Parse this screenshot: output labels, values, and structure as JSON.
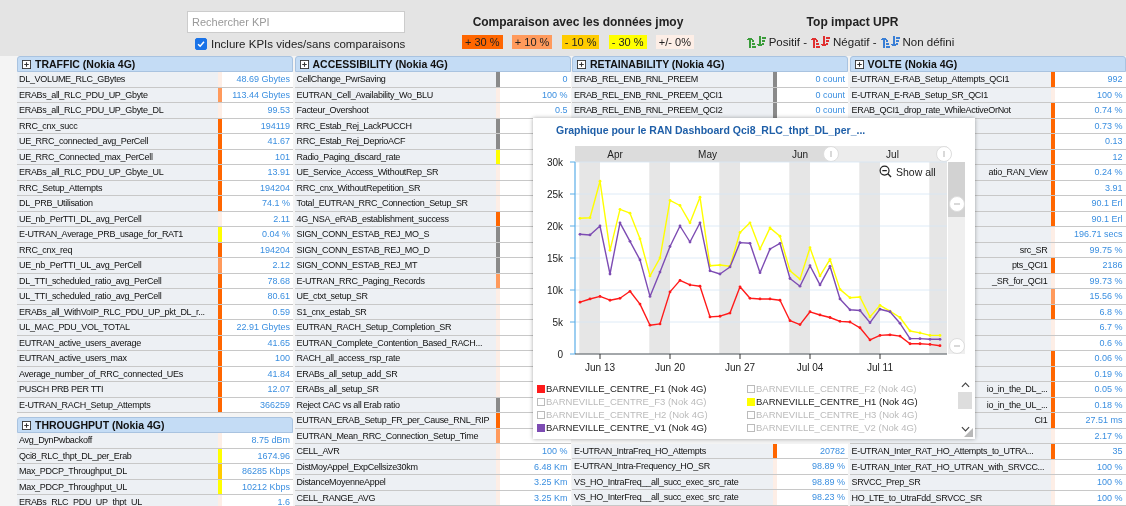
{
  "toolbar": {
    "search": {
      "placeholder": "Rechercher KPI"
    },
    "include_empty": {
      "label": "Inclure KPIs vides/sans comparaisons",
      "checked": true
    },
    "comparison": {
      "title": "Comparaison avec les données jmoy",
      "chips": [
        {
          "label": "+ 30 %",
          "color": "#ff6600"
        },
        {
          "label": "+ 10 %",
          "color": "#ff9a5c"
        },
        {
          "label": "- 10 %",
          "color": "#ffcc00"
        },
        {
          "label": "- 30 %",
          "color": "#ffff00"
        },
        {
          "label": "+/- 0%",
          "color": "#fdeee6"
        }
      ]
    },
    "impact": {
      "title": "Top impact UPR",
      "items": [
        {
          "label": "Positif -",
          "color": "#3a9c3a"
        },
        {
          "label": "Négatif -",
          "color": "#e03030"
        },
        {
          "label": "Non défini",
          "color": "#3a7fd5"
        }
      ]
    }
  },
  "columns": [
    {
      "sections": [
        {
          "title": "TRAFFIC (Nokia 4G)",
          "rows": [
            {
              "name": "DL_VOLUME_RLC_GBytes",
              "value": "48.69 Gbytes",
              "color": "#fdeee6"
            },
            {
              "name": "ERABs_all_RLC_PDU_UP_Gbyte",
              "value": "113.44 Gbytes",
              "color": "#ff9a5c"
            },
            {
              "name": "ERABs_all_RLC_PDU_UP_Gbyte_DL",
              "value": "99.53",
              "color": "#fdeee6"
            },
            {
              "name": "RRC_cnx_succ",
              "value": "194119",
              "color": "#ff6600"
            },
            {
              "name": "UE_RRC_connected_avg_PerCell",
              "value": "41.67",
              "color": "#ff6600"
            },
            {
              "name": "UE_RRC_Connected_max_PerCell",
              "value": "101",
              "color": "#ff6600"
            },
            {
              "name": "ERABs_all_RLC_PDU_UP_Gbyte_UL",
              "value": "13.91",
              "color": "#ff6600"
            },
            {
              "name": "RRC_Setup_Attempts",
              "value": "194204",
              "color": "#ff6600"
            },
            {
              "name": "DL_PRB_Utilisation",
              "value": "74.1 %",
              "color": "#ff6600"
            },
            {
              "name": "UE_nb_PerTTI_DL_avg_PerCell",
              "value": "2.11",
              "color": "#fdeee6"
            },
            {
              "name": "E-UTRAN_Average_PRB_usage_for_RAT1",
              "value": "0.04 %",
              "color": "#ffff00"
            },
            {
              "name": "RRC_cnx_req",
              "value": "194204",
              "color": "#ff6600"
            },
            {
              "name": "UE_nb_PerTTI_UL_avg_PerCell",
              "value": "2.12",
              "color": "#ff9a5c"
            },
            {
              "name": "DL_TTI_scheduled_ratio_avg_PerCell",
              "value": "78.68",
              "color": "#ff6600"
            },
            {
              "name": "UL_TTI_scheduled_ratio_avg_PerCell",
              "value": "80.61",
              "color": "#ff6600"
            },
            {
              "name": "ERABs_all_WithVoIP_RLC_PDU_UP_pkt_DL_r...",
              "value": "0.59",
              "color": "#ff6600"
            },
            {
              "name": "UL_MAC_PDU_VOL_TOTAL",
              "value": "22.91 Gbytes",
              "color": "#ff6600"
            },
            {
              "name": "EUTRAN_active_users_average",
              "value": "41.65",
              "color": "#ff6600"
            },
            {
              "name": "EUTRAN_active_users_max",
              "value": "100",
              "color": "#ff6600"
            },
            {
              "name": "Average_number_of_RRC_connected_UEs",
              "value": "41.84",
              "color": "#ff6600"
            },
            {
              "name": "PUSCH PRB PER TTI",
              "value": "12.07",
              "color": "#ff6600"
            },
            {
              "name": "E-UTRAN_RACH_Setup_Attempts",
              "value": "366259",
              "color": "#ff6600"
            }
          ]
        },
        {
          "title": "THROUGHPUT (Nokia 4G)",
          "rows": [
            {
              "name": "Avg_DynPwbackoff",
              "value": "8.75 dBm",
              "color": "#fdeee6"
            },
            {
              "name": "Qci8_RLC_thpt_DL_per_Erab",
              "value": "1674.96",
              "color": "#ffff00"
            },
            {
              "name": "Max_PDCP_Throughput_DL",
              "value": "86285 Kbps",
              "color": "#ffcc00"
            },
            {
              "name": "Max_PDCP_Throughput_UL",
              "value": "10212 Kbps",
              "color": "#ffff00"
            },
            {
              "name": "ERABs_RLC_PDU_UP_thpt_UL",
              "value": "1.6",
              "color": "#fdeee6"
            }
          ]
        }
      ]
    },
    {
      "sections": [
        {
          "title": "ACCESSIBILITY (Nokia 4G)",
          "rows": [
            {
              "name": "CellChange_PwrSaving",
              "value": "0",
              "color": "#8a8a8a"
            },
            {
              "name": "EUTRAN_Cell_Availability_Wo_BLU",
              "value": "100 %",
              "color": "#fdeee6"
            },
            {
              "name": "Facteur_Overshoot",
              "value": "0.5",
              "color": "#fdeee6"
            },
            {
              "name": "RRC_Estab_Rej_LackPUCCH",
              "color": "#8a8a8a"
            },
            {
              "name": "RRC_Estab_Rej_DeprioACF",
              "color": "#8a8a8a"
            },
            {
              "name": "Radio_Paging_discard_rate",
              "color": "#ffff00"
            },
            {
              "name": "UE_Service_Access_WithoutRep_SR",
              "color": "#fdeee6"
            },
            {
              "name": "RRC_cnx_WithoutRepetition_SR",
              "color": "#fdeee6"
            },
            {
              "name": "Total_EUTRAN_RRC_Connection_Setup_SR",
              "color": "#fdeee6"
            },
            {
              "name": "4G_NSA_eRAB_establishment_success",
              "color": "#ff6600"
            },
            {
              "name": "SIGN_CONN_ESTAB_REJ_MO_S",
              "color": "#8a8a8a"
            },
            {
              "name": "SIGN_CONN_ESTAB_REJ_MO_D",
              "color": "#8a8a8a"
            },
            {
              "name": "SIGN_CONN_ESTAB_REJ_MT",
              "color": "#8a8a8a"
            },
            {
              "name": "E-UTRAN_RRC_Paging_Records",
              "color": "#ff9a5c"
            },
            {
              "name": "UE_ctxt_setup_SR",
              "color": "#fdeee6"
            },
            {
              "name": "S1_cnx_estab_SR",
              "color": "#fdeee6"
            },
            {
              "name": "EUTRAN_RACH_Setup_Completion_SR",
              "color": "#fdeee6"
            },
            {
              "name": "EUTRAN_Complete_Contention_Based_RACH...",
              "color": "#fdeee6"
            },
            {
              "name": "RACH_all_access_rsp_rate",
              "color": "#fdeee6"
            },
            {
              "name": "ERABs_all_setup_add_SR",
              "color": "#fdeee6"
            },
            {
              "name": "ERABs_all_setup_SR",
              "color": "#fdeee6"
            },
            {
              "name": "Reject CAC vs all Erab ratio",
              "color": "#8a8a8a"
            },
            {
              "name": "EUTRAN_ERAB_Setup_FR_per_Cause_RNL_RIP",
              "color": "#ff6600"
            },
            {
              "name": "EUTRAN_Mean_RRC_Connection_Setup_Time",
              "color": "#ff9a5c"
            },
            {
              "name": "CELL_AVR",
              "value": "100 %",
              "color": "#fdeee6"
            },
            {
              "name": "DistMoyAppel_ExpCellsize30km",
              "value": "6.48 Km",
              "color": "#fdeee6"
            },
            {
              "name": "DistanceMoyenneAppel",
              "value": "3.25 Km",
              "color": "#fdeee6"
            },
            {
              "name": "CELL_RANGE_AVG",
              "value": "3.25 Km",
              "color": "#fdeee6"
            }
          ]
        }
      ]
    },
    {
      "sections": [
        {
          "title": "RETAINABILITY (Nokia 4G)",
          "rows": [
            {
              "name": "ERAB_REL_ENB_RNL_PREEM",
              "value": "0 count",
              "color": "#8a8a8a"
            },
            {
              "name": "ERAB_REL_ENB_RNL_PREEM_QCI1",
              "value": "0 count",
              "color": "#8a8a8a"
            },
            {
              "name": "ERAB_REL_ENB_RNL_PREEM_QCI2",
              "value": "0 count",
              "color": "#8a8a8a"
            }
          ],
          "lower_rows": [
            {
              "name": "E-UTRAN_IntraFreq_HO_Attempts",
              "value": "20782",
              "color": "#ff6600"
            },
            {
              "name": "E-UTRAN_Intra-Frequency_HO_SR",
              "value": "98.89 %",
              "color": "#fdeee6"
            },
            {
              "name": "VS_HO_IntraFreq__all_succ_exec_src_rate",
              "value": "98.89 %",
              "color": "#fdeee6"
            },
            {
              "name": "VS_HO_InterFreq__all_succ_exec_src_rate",
              "value": "98.23 %",
              "color": "#fdeee6"
            }
          ]
        }
      ]
    },
    {
      "sections": [
        {
          "title": "VOLTE (Nokia 4G)",
          "rows": [
            {
              "kind": "full",
              "name": "E-UTRAN_E-RAB_Setup_Attempts_QCI1",
              "value": "992",
              "color": "#ff6600"
            },
            {
              "kind": "full",
              "name": "E-UTRAN_E-RAB_Setup_SR_QCI1",
              "value": "100 %",
              "color": "#fdeee6"
            },
            {
              "kind": "full",
              "name": "ERAB_QCI1_drop_rate_WhileActiveOrNot",
              "value": "0.74 %",
              "color": "#ff6600"
            },
            {
              "kind": "clipped",
              "value": "0.73 %",
              "color": "#ff6600"
            },
            {
              "kind": "clipped",
              "value": "0.13",
              "color": "#ff6600"
            },
            {
              "kind": "clipped",
              "value": "12",
              "color": "#ff6600"
            },
            {
              "kind": "clipped",
              "name": "atio_RAN_View",
              "value": "0.24 %",
              "color": "#ff6600"
            },
            {
              "kind": "clipped",
              "value": "3.91",
              "color": "#ff6600"
            },
            {
              "kind": "clipped",
              "value": "90.1 Erl",
              "color": "#ff6600"
            },
            {
              "kind": "clipped",
              "value": "90.1 Erl",
              "color": "#ff6600"
            },
            {
              "kind": "clipped",
              "value": "196.71 secs",
              "color": "#fdeee6"
            },
            {
              "kind": "clipped",
              "name": "src_SR",
              "value": "99.75 %",
              "color": "#fdeee6"
            },
            {
              "kind": "clipped",
              "name": "pts_QCI1",
              "value": "2186",
              "color": "#ff6600"
            },
            {
              "kind": "clipped",
              "name": "_SR_for_QCI1",
              "value": "99.73 %",
              "color": "#fdeee6"
            },
            {
              "kind": "clipped",
              "value": "15.56 %",
              "color": "#ff9a5c"
            },
            {
              "kind": "clipped",
              "value": "6.8 %",
              "color": "#ff6600"
            },
            {
              "kind": "clipped",
              "value": "6.7 %",
              "color": "#fdeee6"
            },
            {
              "kind": "clipped",
              "value": "0.6 %",
              "color": "#fdeee6"
            },
            {
              "kind": "clipped",
              "value": "0.06 %",
              "color": "#ff6600"
            },
            {
              "kind": "clipped",
              "value": "0.19 %",
              "color": "#ff6600"
            },
            {
              "kind": "clipped",
              "name": "io_in_the_DL_...",
              "value": "0.05 %",
              "color": "#ff6600"
            },
            {
              "kind": "clipped",
              "name": "io_in_the_UL_...",
              "value": "0.18 %",
              "color": "#ff6600"
            },
            {
              "kind": "clipped",
              "name": "CI1",
              "value": "27.51 ms",
              "color": "#ff6600"
            },
            {
              "kind": "clipped",
              "value": "2.17 %",
              "color": "#fdeee6"
            },
            {
              "kind": "full",
              "name": "E-UTRAN_Inter_RAT_HO_Attempts_to_UTRA...",
              "value": "35",
              "color": "#ff6600"
            },
            {
              "kind": "full",
              "name": "E-UTRAN_Inter_RAT_HO_UTRAN_with_SRVCC...",
              "value": "100 %",
              "color": "#fdeee6"
            },
            {
              "kind": "full",
              "name": "SRVCC_Prep_SR",
              "value": "100 %",
              "color": "#fdeee6"
            },
            {
              "kind": "full",
              "name": "HO_LTE_to_UtraFdd_SRVCC_SR",
              "value": "100 %",
              "color": "#fdeee6"
            }
          ]
        }
      ]
    }
  ],
  "chart": {
    "title": "Graphique pour le RAN Dashboard Qci8_RLC_thpt_DL_per_...",
    "navigator": {
      "months": [
        "Apr",
        "May",
        "Jun",
        "Jul"
      ]
    },
    "show_all": "Show all",
    "chart_data": {
      "type": "line",
      "categories": [
        null,
        null,
        "Jun 13",
        null,
        null,
        null,
        null,
        null,
        null,
        "Jun 20",
        null,
        null,
        null,
        null,
        null,
        null,
        "Jun 27",
        null,
        null,
        null,
        null,
        null,
        null,
        "Jul 04",
        null,
        null,
        null,
        null,
        null,
        null,
        "Jul 11",
        null,
        null,
        null,
        null,
        null,
        null
      ],
      "ylim": [
        0,
        30000
      ],
      "grid": true,
      "yticks": [
        {
          "value": 0,
          "label": "0"
        },
        {
          "value": 5000,
          "label": "5k"
        },
        {
          "value": 10000,
          "label": "10k"
        },
        {
          "value": 15000,
          "label": "15k"
        },
        {
          "value": 20000,
          "label": "20k"
        },
        {
          "value": 25000,
          "label": "25k"
        },
        {
          "value": 30000,
          "label": "30k"
        }
      ],
      "series": [
        {
          "name": "BARNEVILLE_CENTRE_F1 (Nok 4G)",
          "color": "#ff1a1a",
          "values": [
            8100,
            8600,
            9000,
            8400,
            8700,
            9800,
            7800,
            4500,
            4700,
            9700,
            11500,
            10800,
            10600,
            5800,
            5900,
            6400,
            10500,
            8700,
            8600,
            8600,
            8400,
            5200,
            4600,
            6600,
            6100,
            5700,
            5100,
            5000,
            4100,
            2200,
            2900,
            3000,
            2800,
            1600,
            1600,
            1500,
            1300
          ]
        },
        {
          "name": "BARNEVILLE_CENTRE_H1 (Nok 4G)",
          "color": "#ffff00",
          "values": [
            21200,
            21300,
            27000,
            16200,
            22600,
            22000,
            18000,
            12200,
            15000,
            24000,
            23200,
            20500,
            24500,
            13800,
            13900,
            13700,
            19000,
            20500,
            16400,
            19700,
            18400,
            13000,
            11700,
            16600,
            12200,
            14800,
            10100,
            8800,
            8900,
            5800,
            7600,
            6700,
            5700,
            3600,
            3300,
            2900,
            2900
          ]
        },
        {
          "name": "BARNEVILLE_CENTRE_V1 (Nok 4G)",
          "color": "#7d4cb3",
          "values": [
            18700,
            18600,
            20000,
            12500,
            20500,
            17600,
            14700,
            9000,
            12800,
            16800,
            20000,
            17500,
            20500,
            13000,
            12500,
            13600,
            17400,
            17300,
            12700,
            16400,
            17300,
            11800,
            10600,
            13800,
            10800,
            13700,
            8600,
            6900,
            6800,
            4900,
            7000,
            6600,
            4800,
            2400,
            2400,
            2300,
            2300
          ]
        }
      ]
    },
    "legend": [
      {
        "kind": "series"
      },
      {
        "kind": "hidden",
        "label": "BARNEVILLE_CENTRE_F2 (Nok 4G)"
      },
      {
        "kind": "hidden",
        "label": "BARNEVILLE_CENTRE_F3 (Nok 4G)"
      },
      {
        "kind": "series"
      },
      {
        "kind": "hidden",
        "label": "BARNEVILLE_CENTRE_H2 (Nok 4G)"
      },
      {
        "kind": "hidden",
        "label": "BARNEVILLE_CENTRE_H3 (Nok 4G)"
      },
      {
        "kind": "series"
      },
      {
        "kind": "hidden",
        "label": "BARNEVILLE_CENTRE_V2 (Nok 4G)"
      }
    ]
  }
}
